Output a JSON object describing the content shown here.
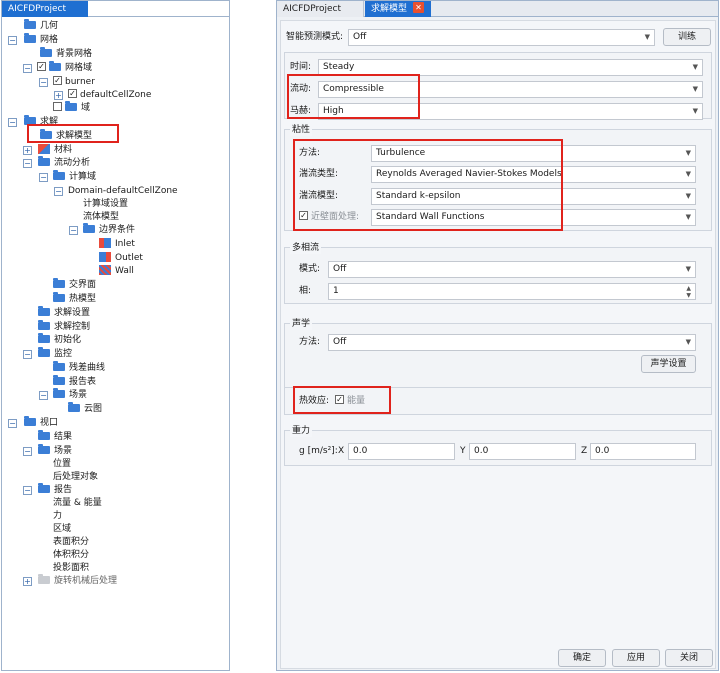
{
  "left": {
    "tab": "AICFDProject",
    "tree": [
      {
        "label": "几何"
      },
      {
        "label": "网格"
      },
      {
        "label": "背景网格"
      },
      {
        "label": "网格域"
      },
      {
        "label": "burner"
      },
      {
        "label": "defaultCellZone"
      },
      {
        "label": "域"
      },
      {
        "label": "求解"
      },
      {
        "label": "求解模型"
      },
      {
        "label": "材料"
      },
      {
        "label": "流动分析"
      },
      {
        "label": "计算域"
      },
      {
        "label": "Domain-defaultCellZone"
      },
      {
        "label": "计算域设置"
      },
      {
        "label": "流体模型"
      },
      {
        "label": "边界条件"
      },
      {
        "label": "Inlet"
      },
      {
        "label": "Outlet"
      },
      {
        "label": "Wall"
      },
      {
        "label": "交界面"
      },
      {
        "label": "热模型"
      },
      {
        "label": "求解设置"
      },
      {
        "label": "求解控制"
      },
      {
        "label": "初始化"
      },
      {
        "label": "监控"
      },
      {
        "label": "残差曲线"
      },
      {
        "label": "报告表"
      },
      {
        "label": "场景"
      },
      {
        "label": "云图"
      },
      {
        "label": "视口"
      },
      {
        "label": "结果"
      },
      {
        "label": "场景"
      },
      {
        "label": "位置"
      },
      {
        "label": "后处理对象"
      },
      {
        "label": "报告"
      },
      {
        "label": "流量 & 能量"
      },
      {
        "label": "力"
      },
      {
        "label": "区域"
      },
      {
        "label": "表面积分"
      },
      {
        "label": "体积积分"
      },
      {
        "label": "投影面积"
      },
      {
        "label": "旋转机械后处理"
      }
    ]
  },
  "right": {
    "tabs": [
      "AICFDProject",
      "求解模型"
    ],
    "close_icon": "✕",
    "smart_label": "智能预测模式:",
    "smart_value": "Off",
    "train_button": "训练",
    "time_label": "时间:",
    "time_value": "Steady",
    "flow_label": "流动:",
    "flow_value": "Compressible",
    "mach_label": "马赫:",
    "mach_value": "High",
    "viscosity": {
      "title": "粘性",
      "method_label": "方法:",
      "method_value": "Turbulence",
      "turb_type_label": "湍流类型:",
      "turb_type_value": "Reynolds Averaged Navier-Stokes Models",
      "turb_model_label": "湍流模型:",
      "turb_model_value": "Standard k-epsilon",
      "wall_label": "近壁面处理:",
      "wall_value": "Standard Wall Functions"
    },
    "multiphase": {
      "title": "多相流",
      "mode_label": "模式:",
      "mode_value": "Off",
      "phase_label": "相:",
      "phase_value": "1"
    },
    "acoustics": {
      "title": "声学",
      "method_label": "方法:",
      "method_value": "Off",
      "settings_button": "声学设置"
    },
    "thermal": {
      "label": "热效应:",
      "energy_label": "能量"
    },
    "gravity": {
      "title": "重力",
      "unit_label": "g [m/s²]:",
      "x_label": "X",
      "x_value": "0.0",
      "y_label": "Y",
      "y_value": "0.0",
      "z_label": "Z",
      "z_value": "0.0"
    },
    "ok_button": "确定",
    "apply_button": "应用",
    "close_button": "关闭"
  },
  "colors": {
    "accent": "#1f6fd1",
    "highlight_box": "#e0231c",
    "folder": "#3b7ed6"
  }
}
